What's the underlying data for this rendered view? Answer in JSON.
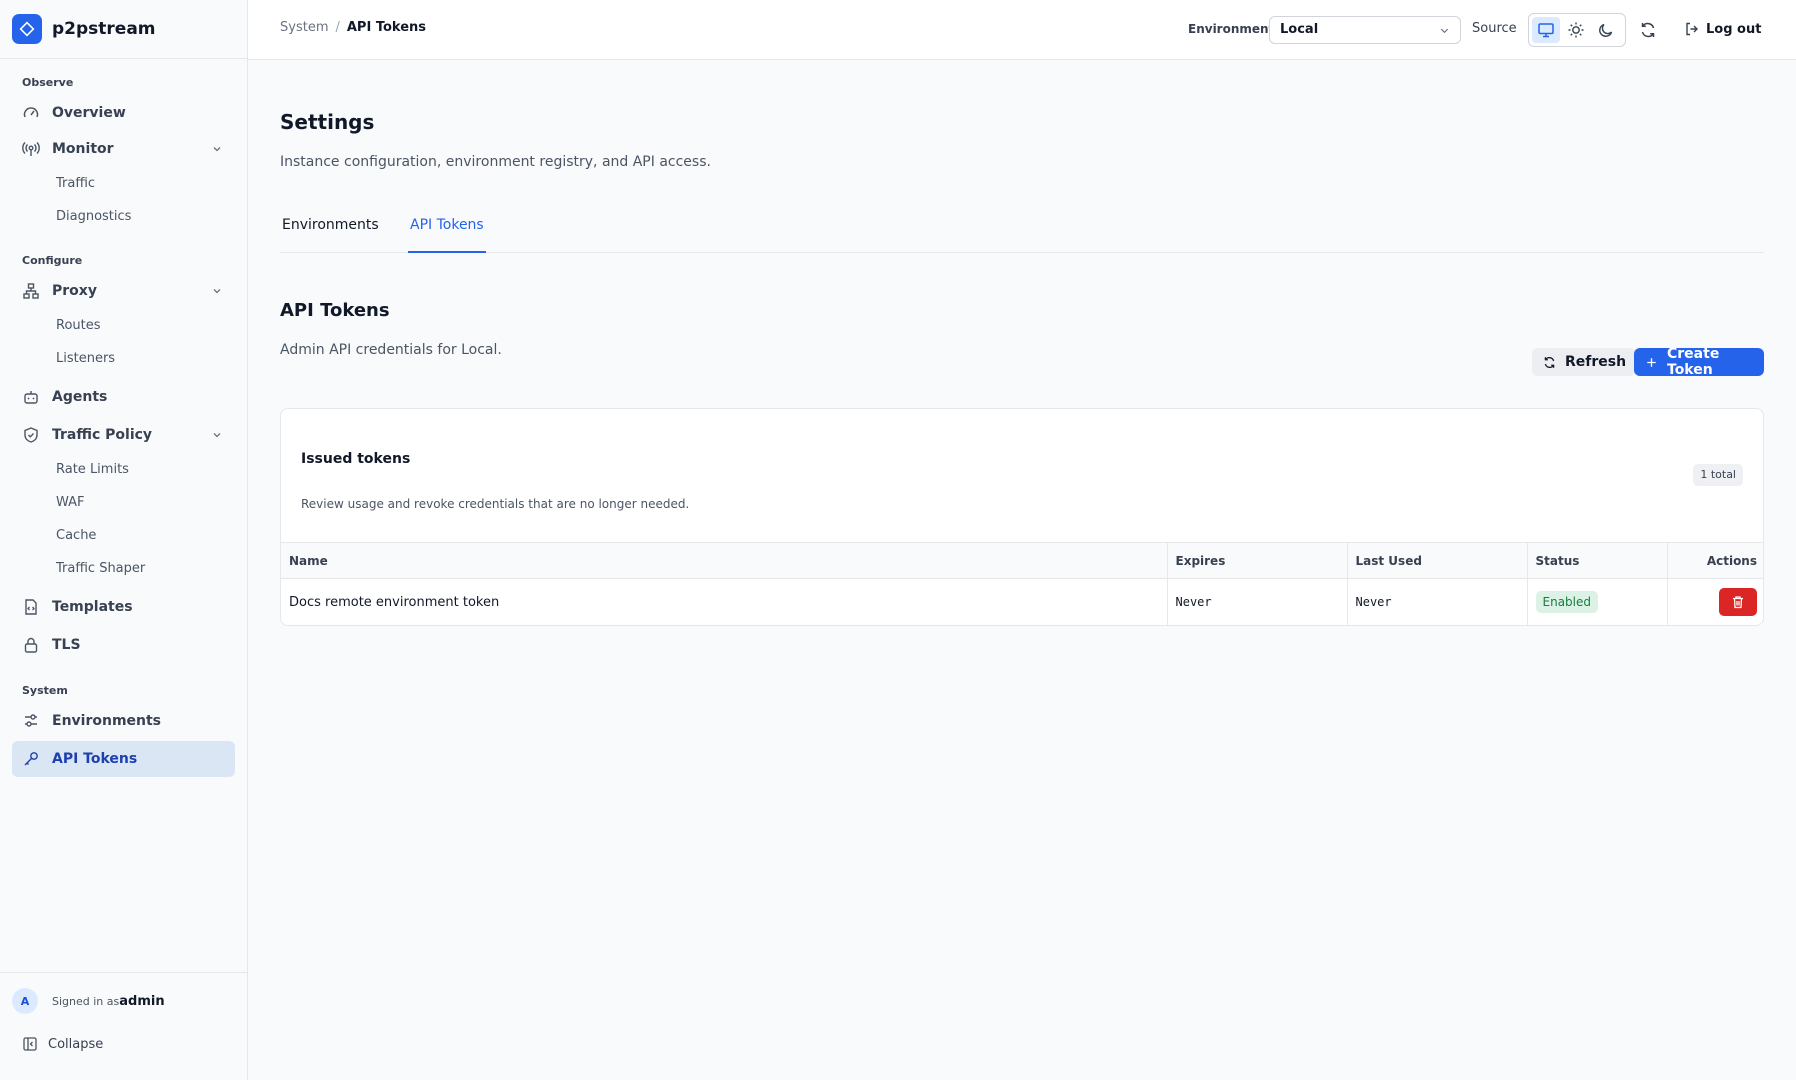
{
  "brand": {
    "name": "p2pstream"
  },
  "sidebar": {
    "sections": {
      "observe": "Observe",
      "configure": "Configure",
      "system": "System"
    },
    "overview": "Overview",
    "monitor": "Monitor",
    "monitor_sub": [
      "Traffic",
      "Diagnostics"
    ],
    "proxy": "Proxy",
    "proxy_sub": [
      "Routes",
      "Listeners"
    ],
    "agents": "Agents",
    "traffic_policy": "Traffic Policy",
    "traffic_policy_sub": [
      "Rate Limits",
      "WAF",
      "Cache",
      "Traffic Shaper"
    ],
    "templates": "Templates",
    "tls": "TLS",
    "environments": "Environments",
    "api_tokens": "API Tokens",
    "footer": {
      "avatar": "A",
      "signed_in_as": "Signed in as",
      "user": "admin",
      "collapse": "Collapse"
    }
  },
  "topbar": {
    "breadcrumb": [
      "System",
      "API Tokens"
    ],
    "breadcrumb_sep": "/",
    "environment_label": "Environment",
    "environment_value": "Local",
    "source_label": "Source",
    "theme_options": [
      "monitor-icon",
      "sun-icon",
      "moon-icon"
    ],
    "theme_selected": "monitor-icon",
    "logout": "Log out"
  },
  "page": {
    "title": "Settings",
    "description": "Instance configuration, environment registry, and API access.",
    "tabs": [
      "Environments",
      "API Tokens"
    ],
    "active_tab": "API Tokens"
  },
  "tokens": {
    "title": "API Tokens",
    "description": "Admin API credentials for Local.",
    "refresh": "Refresh",
    "create": "Create Token",
    "card": {
      "title": "Issued tokens",
      "description": "Review usage and revoke credentials that are no longer needed.",
      "total": "1 total"
    },
    "columns": [
      "Name",
      "Expires",
      "Last Used",
      "Status",
      "Actions"
    ],
    "rows": [
      {
        "name": "Docs remote environment token",
        "expires": "Never",
        "last_used": "Never",
        "status": "Enabled"
      }
    ]
  },
  "colors": {
    "accent": "#2563eb",
    "danger": "#dc2626",
    "success_bg": "#dcf2e6",
    "success_text": "#15803d"
  }
}
